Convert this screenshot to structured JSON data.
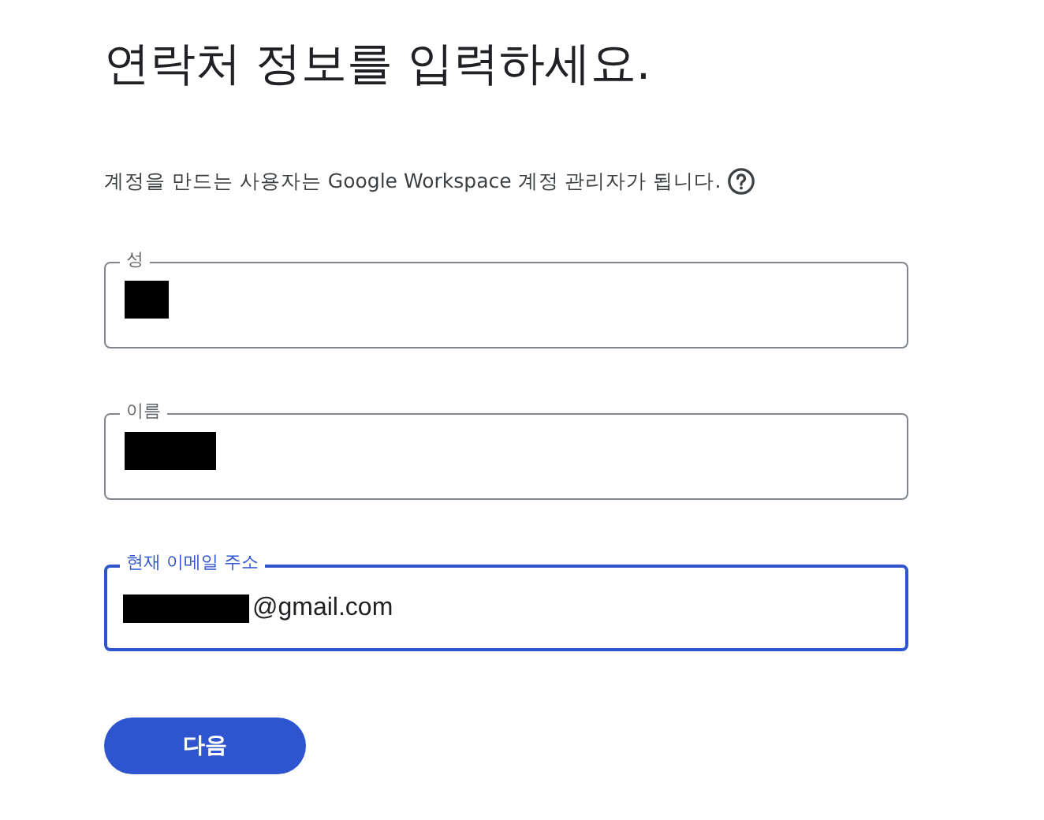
{
  "title": "연락처 정보를 입력하세요.",
  "description": "계정을 만드는 사용자는 Google Workspace 계정 관리자가 됩니다.",
  "fields": [
    {
      "label": "성",
      "redacted": true,
      "focused": false
    },
    {
      "label": "이름",
      "redacted": true,
      "focused": false
    },
    {
      "label": "현재 이메일 주소",
      "redacted": true,
      "value": "@gmail.com",
      "focused": true
    }
  ],
  "next_button": "다음"
}
